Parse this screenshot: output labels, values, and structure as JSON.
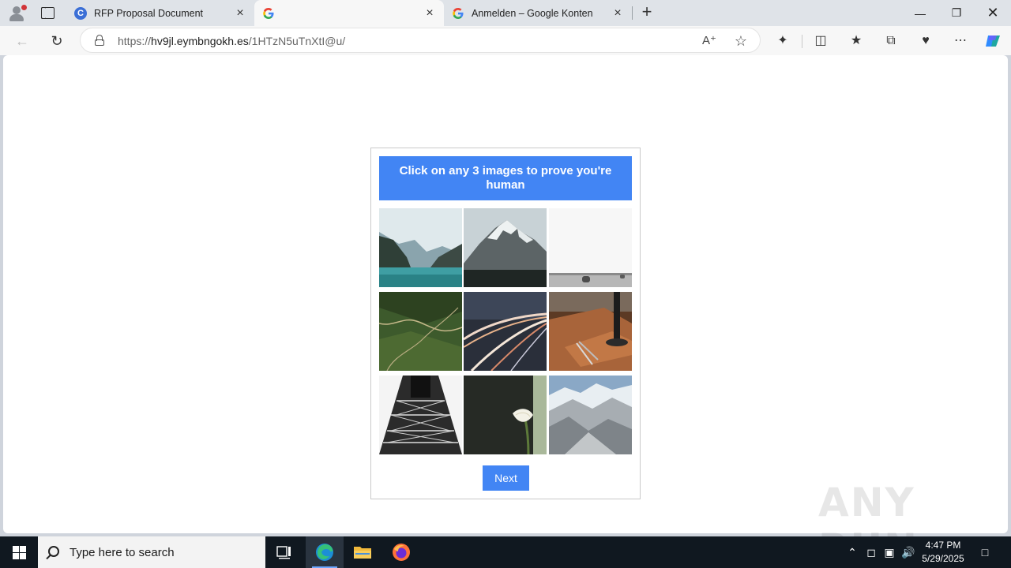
{
  "browser": {
    "tabs": [
      {
        "title": "RFP Proposal Document",
        "favicon": "edge-c-icon",
        "active": false
      },
      {
        "title": "",
        "favicon": "google-g-icon",
        "active": true
      },
      {
        "title": "Anmelden – Google Konten",
        "favicon": "google-g-icon",
        "active": false
      }
    ],
    "new_tab_glyph": "+",
    "url_prefix": "https://",
    "url_host": "hv9jl.eymbngokh.es",
    "url_path": "/1HTzN5uTnXtI@u/"
  },
  "captcha": {
    "prompt": "Click on any 3 images to prove you're human",
    "tiles": [
      {
        "name": "mountain-lake"
      },
      {
        "name": "snowy-mountain"
      },
      {
        "name": "hay-field"
      },
      {
        "name": "aerial-valley"
      },
      {
        "name": "light-trails-road"
      },
      {
        "name": "desk-compass"
      },
      {
        "name": "steel-tower"
      },
      {
        "name": "calla-lily"
      },
      {
        "name": "mountain-range"
      }
    ],
    "next_label": "Next"
  },
  "watermark": "ANY RUN",
  "taskbar": {
    "search_placeholder": "Type here to search",
    "time": "4:47 PM",
    "date": "5/29/2025"
  },
  "colors": {
    "captcha_blue": "#4285f4",
    "taskbar_bg": "#101820"
  }
}
